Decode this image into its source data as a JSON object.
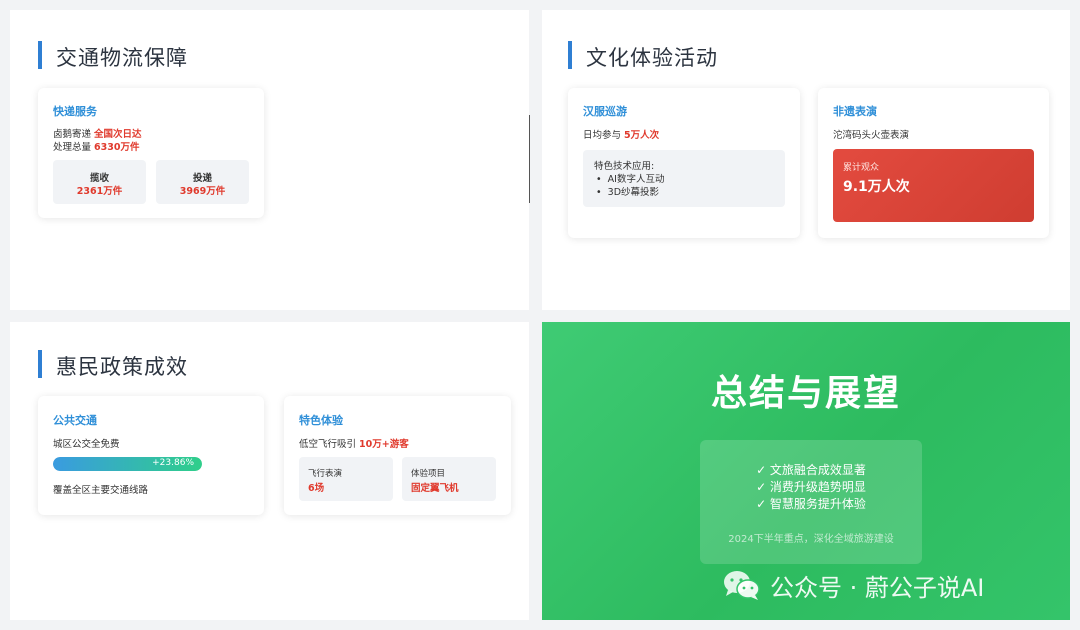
{
  "transport": {
    "title": "交通物流保障",
    "card": {
      "title": "快递服务",
      "line1_prefix": "卤鹅寄递",
      "line1_value": "全国次日达",
      "line2_prefix": "处理总量",
      "line2_value": "6330万件",
      "stats": [
        {
          "label": "揽收",
          "value": "2361万件"
        },
        {
          "label": "投递",
          "value": "3969万件"
        }
      ]
    }
  },
  "culture": {
    "title": "文化体验活动",
    "hanfu": {
      "title": "汉服巡游",
      "line_prefix": "日均参与",
      "line_value": "5万人次",
      "tech_label": "特色技术应用:",
      "tech_items": [
        "AI数字人互动",
        "3D纱幕投影"
      ]
    },
    "heritage": {
      "title": "非遗表演",
      "line": "沱湾码头火壶表演",
      "audience_label": "累计观众",
      "audience_value": "9.1万人次"
    }
  },
  "policy": {
    "title": "惠民政策成效",
    "transit": {
      "title": "公共交通",
      "line": "城区公交全免费",
      "progress_label": "+23.86%",
      "progress_percent": 100,
      "note": "覆盖全区主要交通线路"
    },
    "experience": {
      "title": "特色体验",
      "line_prefix": "低空飞行吸引",
      "line_value": "10万+游客",
      "stats": [
        {
          "label": "飞行表演",
          "value": "6场"
        },
        {
          "label": "体验项目",
          "value": "固定翼飞机"
        }
      ]
    }
  },
  "summary": {
    "title": "总结与展望",
    "checks": [
      "✓ 文旅融合成效显著",
      "✓ 消费升级趋势明显",
      "✓ 智慧服务提升体验"
    ],
    "footer": "2024下半年重点，深化全域旅游建设",
    "watermark": "公众号 · 蔚公子说AI"
  },
  "colors": {
    "accent_blue": "#2f8fd8",
    "highlight_red": "#e0392c",
    "summary_green": "#34c46a"
  }
}
